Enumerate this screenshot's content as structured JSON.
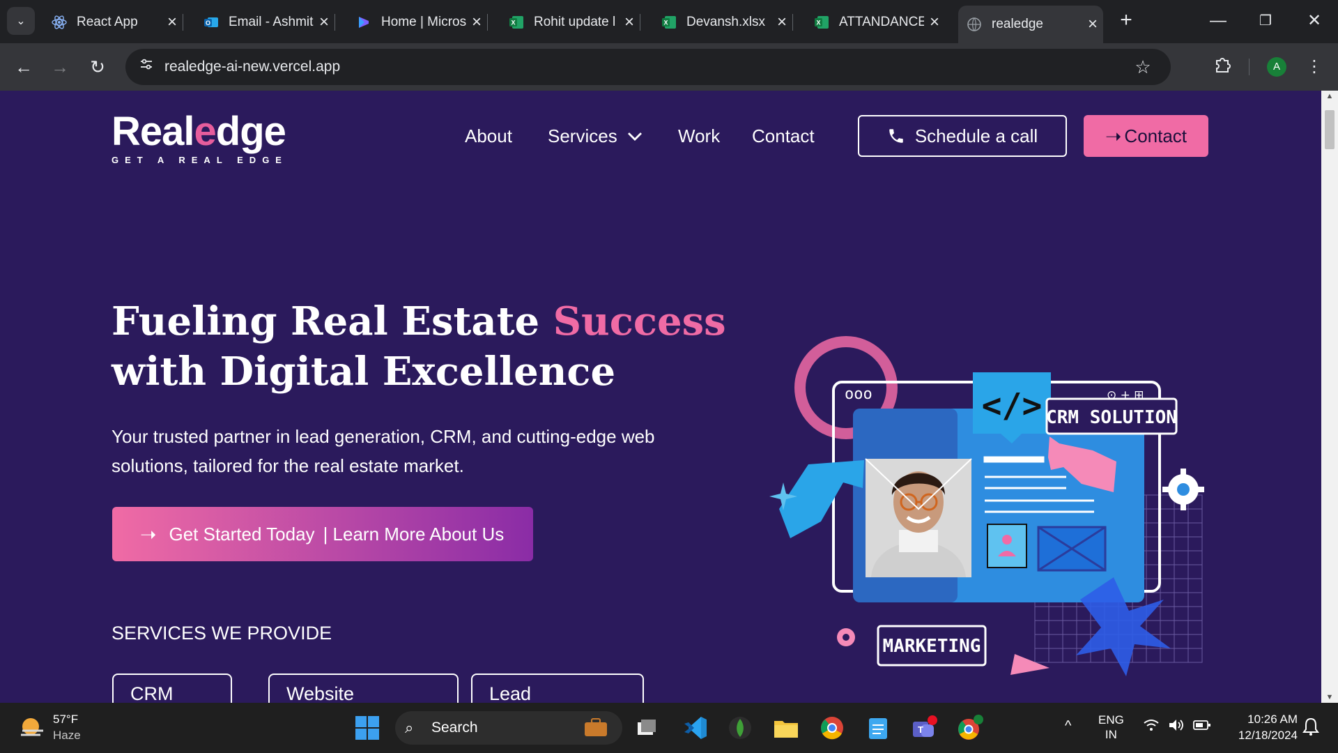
{
  "browser": {
    "tabs": [
      {
        "title": "React App",
        "active": false
      },
      {
        "title": "Email - Ashmit",
        "active": false
      },
      {
        "title": "Home | Micros",
        "active": false
      },
      {
        "title": "Rohit update l",
        "active": false
      },
      {
        "title": "Devansh.xlsx",
        "active": false
      },
      {
        "title": "ATTANDANCE",
        "active": false
      },
      {
        "title": "realedge",
        "active": true
      }
    ],
    "url": "realedge-ai-new.vercel.app",
    "profile_initial": "A"
  },
  "site": {
    "logo_word_1": "Real",
    "logo_e": "e",
    "logo_word_2": "dge",
    "logo_tagline": "GET A REAL EDGE",
    "nav": {
      "about": "About",
      "services": "Services",
      "work": "Work",
      "contact": "Contact"
    },
    "schedule_label": "Schedule a call",
    "contact_label": "Contact",
    "hero_line1": "Fueling Real Estate ",
    "hero_accent": "Success",
    "hero_line2": "with Digital Excellence",
    "subtitle": "Your trusted partner in lead generation, CRM, and cutting-edge web solutions, tailored for the real estate market.",
    "cta_get_started": "Get Started Today",
    "cta_learn_more": "| Learn More About Us",
    "services_heading": "SERVICES WE PROVIDE",
    "services": [
      "CRM Solution",
      "Website Designing",
      "Lead Generation"
    ],
    "illustration": {
      "crm_label": "CRM SOLUTION",
      "marketing_label": "MARKETING",
      "code_label": "</>",
      "window_dots": "ooo",
      "window_tools": "⊙ + ⊞"
    }
  },
  "taskbar": {
    "weather_temp": "57°F",
    "weather_desc": "Haze",
    "search_placeholder": "Search",
    "lang_1": "ENG",
    "lang_2": "IN",
    "time": "10:26 AM",
    "date": "12/18/2024"
  },
  "colors": {
    "page_bg": "#2b1a5c",
    "accent_pink": "#f06ba5",
    "cta_end": "#8a2ca6",
    "illus_blue": "#2e8de0"
  }
}
